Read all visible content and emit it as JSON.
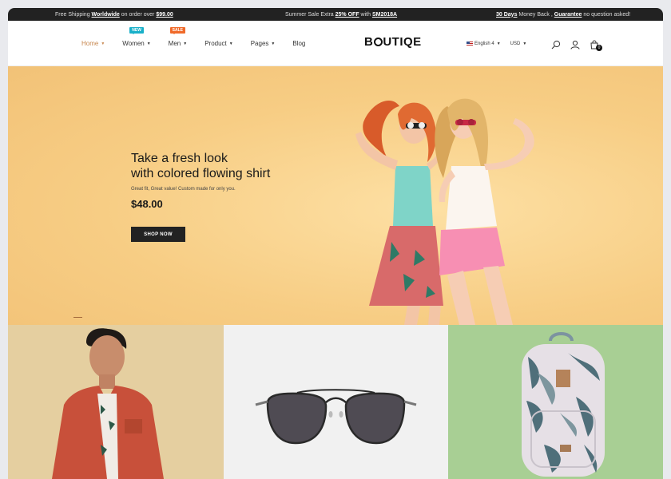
{
  "topbar": {
    "msg1_pre": "Free Shipping ",
    "msg1_bold": "Worldwide",
    "msg1_mid": " on order over ",
    "msg1_bold2": "$99.00",
    "msg2_pre": "Summer Sale Extra ",
    "msg2_bold": "25% OFF",
    "msg2_mid": " with ",
    "msg2_bold2": "SM2018A",
    "msg3_bold": "30 Days",
    "msg3_mid": " Money Back , ",
    "msg3_bold2": "Guarantee",
    "msg3_post": " no question asked!"
  },
  "nav": {
    "home": "Home",
    "women": "Women",
    "women_badge": "NEW",
    "men": "Men",
    "men_badge": "SALE",
    "product": "Product",
    "pages": "Pages",
    "blog": "Blog"
  },
  "logo": {
    "pre": "B",
    "post": "UTIQE"
  },
  "utils": {
    "language": "English 4",
    "currency": "USD",
    "cart_count": "0"
  },
  "hero": {
    "title_line1": "Take a fresh look",
    "title_line2": "with colored flowing shirt",
    "subtitle": "Great fit, Great value! Custom made for only you.",
    "price": "$48.00",
    "button": "SHOP NOW"
  },
  "colors": {
    "accent": "#c7874f",
    "hero_bg": "#f7cd84",
    "badge_new": "#19b0c9",
    "badge_sale": "#f06a2a"
  }
}
